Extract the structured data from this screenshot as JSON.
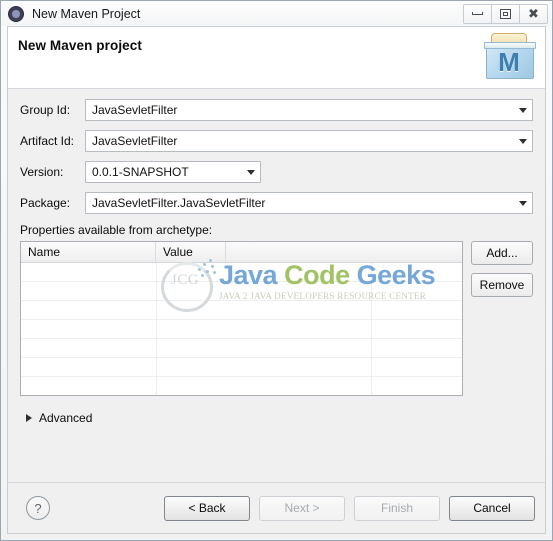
{
  "window": {
    "title": "New Maven Project",
    "app_icon": "eclipse-gear-icon",
    "controls": {
      "minimize": "minimize-icon",
      "restore": "restore-icon",
      "close": "close-icon"
    }
  },
  "banner": {
    "title": "New Maven project",
    "icon": "maven-project-icon",
    "icon_letter": "M"
  },
  "form": {
    "fields": [
      {
        "label": "Group Id:",
        "value": "JavaSevletFilter",
        "width": "wide"
      },
      {
        "label": "Artifact Id:",
        "value": "JavaSevletFilter",
        "width": "wide"
      },
      {
        "label": "Version:",
        "value": "0.0.1-SNAPSHOT",
        "width": "narrow"
      },
      {
        "label": "Package:",
        "value": "JavaSevletFilter.JavaSevletFilter",
        "width": "wide"
      }
    ]
  },
  "properties": {
    "label": "Properties available from archetype:",
    "columns": [
      "Name",
      "Value",
      ""
    ],
    "rows": [],
    "empty_row_count": 7,
    "buttons": {
      "add": "Add...",
      "remove": "Remove"
    }
  },
  "watermark": {
    "logo_text": "JCG",
    "word1": "Java",
    "word2": "Code",
    "word3": "Geeks",
    "tagline": "JAVA 2 JAVA DEVELOPERS RESOURCE CENTER",
    "color_blue": "#6ea4d6",
    "color_green": "#9dc05e"
  },
  "advanced": {
    "label": "Advanced",
    "expanded": false,
    "icon": "triangle-right-icon"
  },
  "footer": {
    "help_icon": "help-question-icon",
    "buttons": [
      {
        "label": "< Back",
        "enabled": true
      },
      {
        "label": "Next >",
        "enabled": false
      },
      {
        "label": "Finish",
        "enabled": false
      },
      {
        "label": "Cancel",
        "enabled": true
      }
    ]
  }
}
